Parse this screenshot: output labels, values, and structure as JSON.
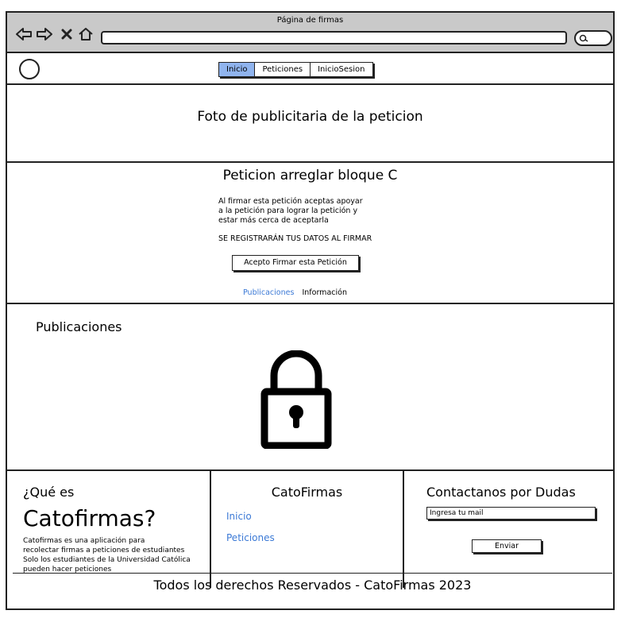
{
  "window": {
    "title": "Página de firmas"
  },
  "nav": {
    "tabs": [
      "Inicio",
      "Peticiones",
      "InicioSesion"
    ],
    "active_tab": "Inicio"
  },
  "hero": {
    "text": "Foto de publicitaria de la peticion"
  },
  "petition": {
    "title": "Peticion arreglar bloque C",
    "description_lines": [
      "Al firmar esta petición aceptas apoyar",
      "a la petición para lograr la petición y",
      "estar más cerca de aceptarla"
    ],
    "notice": "SE REGISTRARÁN TUS DATOS AL FIRMAR",
    "sign_button": "Acepto Firmar esta Petición",
    "links": [
      "Publicaciones",
      "Información"
    ]
  },
  "publications": {
    "title": "Publicaciones",
    "icon": "lock-icon"
  },
  "footer": {
    "about": {
      "question": "¿Qué es",
      "name": "Catofirmas?",
      "description_lines": [
        "Catofirmas es una aplicación para",
        "recolectar firmas a peticiones de estudiantes",
        "Solo los estudiantes de la Universidad Católica",
        "pueden hacer peticiones"
      ]
    },
    "brand": {
      "name": "CatoFirmas",
      "links": [
        "Inicio",
        "Peticiones"
      ]
    },
    "contact": {
      "title": "Contactanos por Dudas",
      "email_value": "Ingresa tu mail",
      "send_label": "Enviar"
    },
    "copyright": "Todos los derechos Reservados - CatoFirmas 2023"
  },
  "colors": {
    "active_tab": "#90b4ee",
    "link": "#3c7ad6",
    "chrome": "#c9c9c9"
  }
}
